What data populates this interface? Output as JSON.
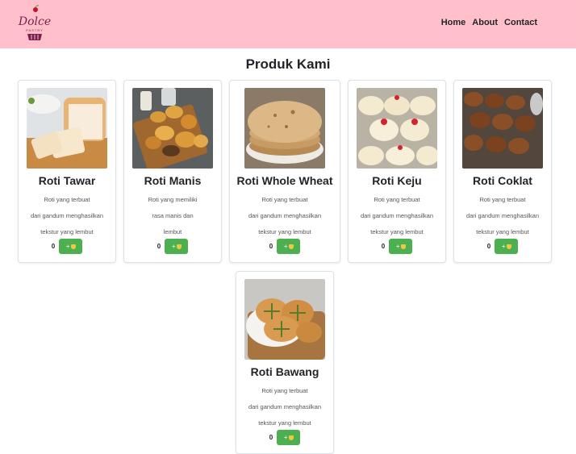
{
  "brand": {
    "logo_text": "Dolce",
    "logo_subtext": "PASTRY"
  },
  "nav": [
    "Home",
    "About",
    "Contact"
  ],
  "page_title": "Produk Kami",
  "add_button_label": "+",
  "products": [
    {
      "name": "Roti Tawar",
      "desc": [
        "Roti yang terbuat",
        "dari gandum menghasilkan",
        "tekstur yang lembut"
      ],
      "qty": "0"
    },
    {
      "name": "Roti Manis",
      "desc": [
        "Roti yang memiliki",
        "rasa manis dan",
        "lembut"
      ],
      "qty": "0"
    },
    {
      "name": "Roti Whole Wheat",
      "desc": [
        "Roti yang terbuat",
        "dari gandum menghasilkan",
        "tekstur yang lembut"
      ],
      "qty": "0"
    },
    {
      "name": "Roti Keju",
      "desc": [
        "Roti yang terbuat",
        "dari gandum menghasilkan",
        "tekstur yang lembut"
      ],
      "qty": "0"
    },
    {
      "name": "Roti Coklat",
      "desc": [
        "Roti yang terbuat",
        "dari gandum menghasilkan",
        "tekstur yang lembut"
      ],
      "qty": "0"
    },
    {
      "name": "Roti Bawang",
      "desc": [
        "Roti yang terbuat",
        "dari gandum menghasilkan",
        "tekstur yang lembut"
      ],
      "qty": "0"
    }
  ]
}
